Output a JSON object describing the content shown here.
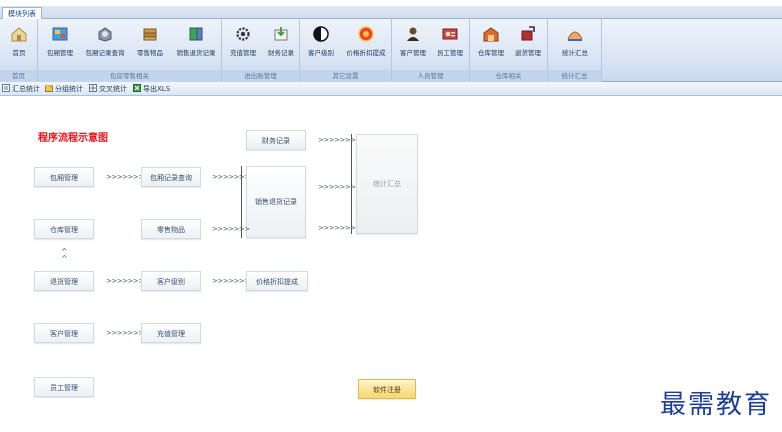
{
  "window": {
    "title": ""
  },
  "ribbon": {
    "tab": "模块列表",
    "groups": [
      {
        "caption": "首页",
        "buttons": [
          {
            "label": "首页",
            "icon": "home-icon",
            "color": "#d8c27a"
          }
        ]
      },
      {
        "caption": "包房零售相关",
        "buttons": [
          {
            "label": "包厢管理",
            "icon": "room-icon",
            "color": "#3f8fd1"
          },
          {
            "label": "包厢记录查询",
            "icon": "record-search-icon",
            "color": "#6e7a8b"
          },
          {
            "label": "零售物品",
            "icon": "goods-icon",
            "color": "#b58a3a"
          },
          {
            "label": "销售退货记录",
            "icon": "sales-return-icon",
            "color": "#3aa55a"
          }
        ]
      },
      {
        "caption": "进出账管理",
        "buttons": [
          {
            "label": "充值管理",
            "icon": "gear-icon",
            "color": "#333333"
          },
          {
            "label": "财务记录",
            "icon": "finance-icon",
            "color": "#4aa04a"
          }
        ]
      },
      {
        "caption": "其它设置",
        "buttons": [
          {
            "label": "客户级别",
            "icon": "contrast-icon",
            "color": "#111111"
          },
          {
            "label": "价格折扣提成",
            "icon": "discount-icon",
            "color": "#e0402a"
          }
        ]
      },
      {
        "caption": "人员管理",
        "buttons": [
          {
            "label": "客户管理",
            "icon": "customer-icon",
            "color": "#6b4a2a"
          },
          {
            "label": "员工管理",
            "icon": "staff-icon",
            "color": "#b23a3a"
          }
        ]
      },
      {
        "caption": "仓库相关",
        "buttons": [
          {
            "label": "仓库管理",
            "icon": "warehouse-icon",
            "color": "#d06020"
          },
          {
            "label": "退货管理",
            "icon": "return-icon",
            "color": "#a03030"
          }
        ]
      },
      {
        "caption": "统计汇总",
        "buttons": [
          {
            "label": "统计汇总",
            "icon": "chart-icon",
            "color": "#e06a2a"
          }
        ]
      }
    ]
  },
  "subbar": {
    "items": [
      {
        "label": "汇总统计",
        "icon": "summary-icon"
      },
      {
        "label": "分组统计",
        "icon": "group-stat-icon"
      },
      {
        "label": "交叉统计",
        "icon": "cross-stat-icon"
      },
      {
        "label": "导出XLS",
        "icon": "export-xls-icon"
      }
    ]
  },
  "flow": {
    "title": "程序流程示意图",
    "arrow": ">>>>>>>",
    "up_mark": "^",
    "boxes": {
      "room_mgmt": "包厢管理",
      "room_record_query": "包厢记录查询",
      "finance_record": "财务记录",
      "sales_return_record": "销售退货记录",
      "stats_summary": "统计汇总",
      "warehouse_mgmt": "仓库管理",
      "retail_goods": "零售物品",
      "return_mgmt": "退货管理",
      "customer_level": "客户级别",
      "price_discount": "价格折扣提成",
      "customer_mgmt": "客户管理",
      "recharge_mgmt": "充值管理",
      "staff_mgmt": "员工管理",
      "software_register": "软件注册"
    }
  },
  "watermark": "最需教育"
}
